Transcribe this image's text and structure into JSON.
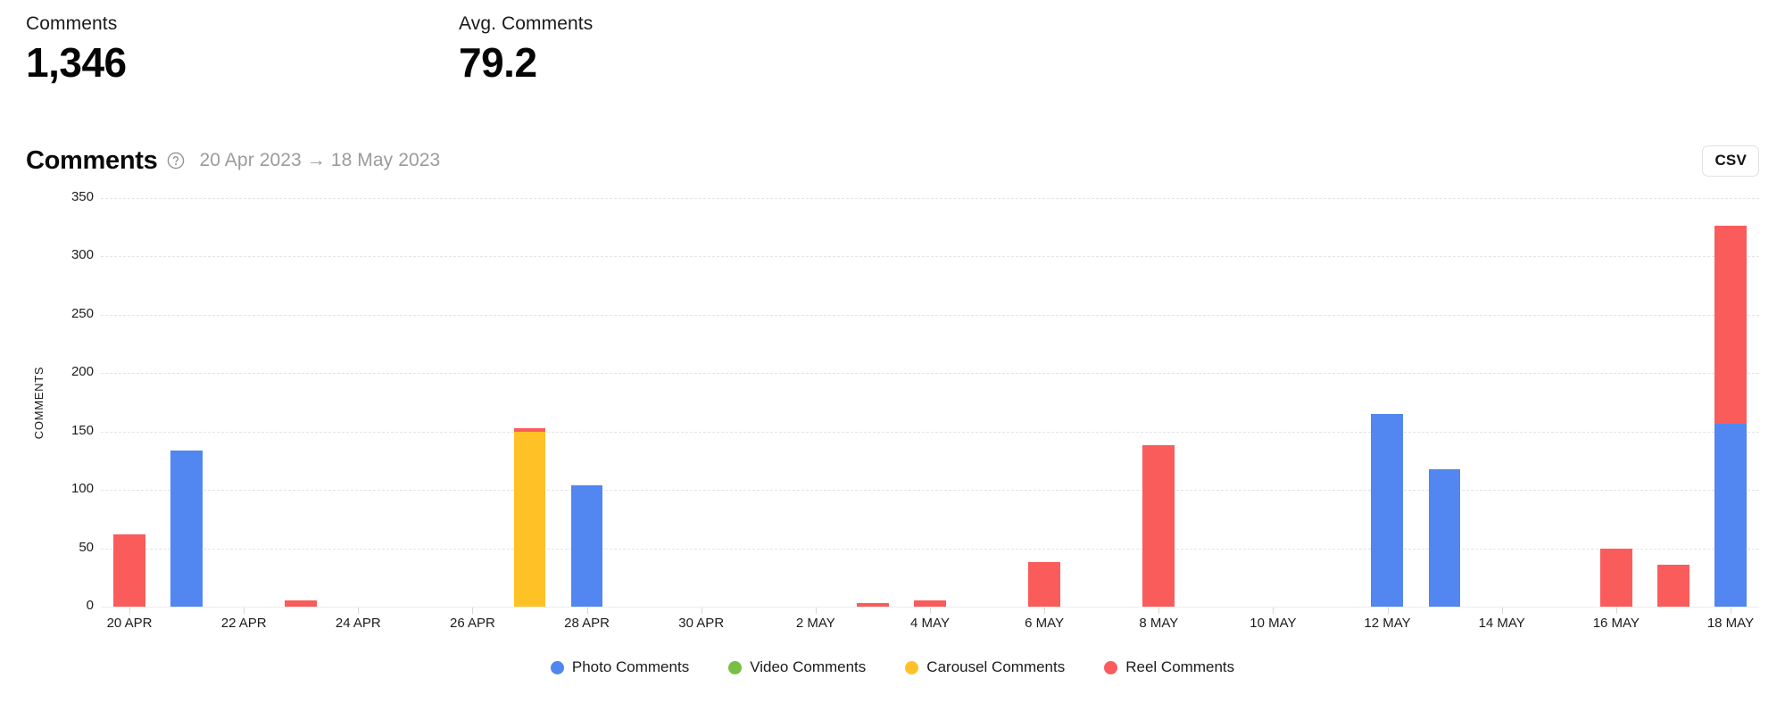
{
  "kpis": [
    {
      "label": "Comments",
      "value": "1,346"
    },
    {
      "label": "Avg. Comments",
      "value": "79.2"
    }
  ],
  "card": {
    "title": "Comments",
    "help_icon": "help-circle-icon",
    "date_range": "20 Apr 2023 → 18 May 2023",
    "csv_label": "CSV"
  },
  "chart_data": {
    "type": "bar",
    "stacked": true,
    "title": "Comments",
    "xlabel": "",
    "ylabel": "COMMENTS",
    "ylim": [
      0,
      350
    ],
    "yticks": [
      0,
      50,
      100,
      150,
      200,
      250,
      300,
      350
    ],
    "ytick_labels": [
      "0",
      "50",
      "100",
      "150",
      "200",
      "250",
      "300",
      "350"
    ],
    "grid": true,
    "legend_position": "bottom",
    "categories": [
      "20 APR",
      "21 APR",
      "22 APR",
      "23 APR",
      "24 APR",
      "25 APR",
      "26 APR",
      "27 APR",
      "28 APR",
      "29 APR",
      "30 APR",
      "1 MAY",
      "2 MAY",
      "3 MAY",
      "4 MAY",
      "5 MAY",
      "6 MAY",
      "7 MAY",
      "8 MAY",
      "9 MAY",
      "10 MAY",
      "11 MAY",
      "12 MAY",
      "13 MAY",
      "14 MAY",
      "15 MAY",
      "16 MAY",
      "17 MAY",
      "18 MAY"
    ],
    "xtick_labels": [
      "20 APR",
      "22 APR",
      "24 APR",
      "26 APR",
      "28 APR",
      "30 APR",
      "2 MAY",
      "4 MAY",
      "6 MAY",
      "8 MAY",
      "10 MAY",
      "12 MAY",
      "14 MAY",
      "16 MAY",
      "18 MAY"
    ],
    "xtick_indices": [
      0,
      2,
      4,
      6,
      8,
      10,
      12,
      14,
      16,
      18,
      20,
      22,
      24,
      26,
      28
    ],
    "series": [
      {
        "name": "Photo Comments",
        "color": "#5286F0",
        "values": [
          0,
          134,
          0,
          0,
          0,
          0,
          0,
          0,
          104,
          0,
          0,
          0,
          0,
          0,
          0,
          0,
          0,
          0,
          0,
          0,
          0,
          0,
          165,
          118,
          0,
          0,
          0,
          0,
          157
        ]
      },
      {
        "name": "Video Comments",
        "color": "#77C043",
        "values": [
          0,
          0,
          0,
          0,
          0,
          0,
          0,
          0,
          0,
          0,
          0,
          0,
          0,
          0,
          0,
          0,
          0,
          0,
          0,
          0,
          0,
          0,
          0,
          0,
          0,
          0,
          0,
          0,
          0
        ]
      },
      {
        "name": "Carousel Comments",
        "color": "#FFC226",
        "values": [
          0,
          0,
          0,
          0,
          0,
          0,
          0,
          150,
          0,
          0,
          0,
          0,
          0,
          0,
          0,
          0,
          0,
          0,
          0,
          0,
          0,
          0,
          0,
          0,
          0,
          0,
          0,
          0,
          0
        ]
      },
      {
        "name": "Reel Comments",
        "color": "#FA5C5C",
        "values": [
          62,
          0,
          0,
          5,
          0,
          0,
          0,
          3,
          0,
          0,
          0,
          0,
          0,
          3,
          5,
          0,
          38,
          0,
          138,
          0,
          0,
          0,
          0,
          0,
          0,
          0,
          50,
          36,
          169
        ]
      }
    ]
  }
}
